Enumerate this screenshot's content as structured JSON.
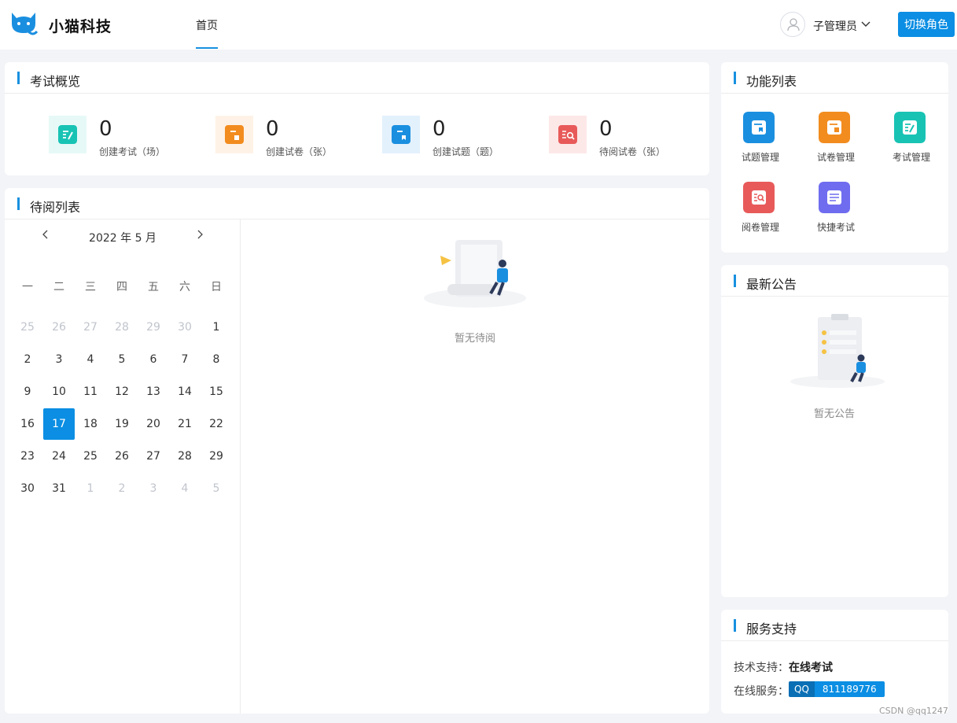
{
  "header": {
    "brand": "小猫科技",
    "nav_home": "首页",
    "user_name": "子管理员",
    "switch_role": "切换角色"
  },
  "overview": {
    "title": "考试概览",
    "stats": [
      {
        "value": "0",
        "label": "创建考试（场）",
        "color": "#18c3b4"
      },
      {
        "value": "0",
        "label": "创建试卷（张）",
        "color": "#f28c1f"
      },
      {
        "value": "0",
        "label": "创建试题（题）",
        "color": "#1a8fe0"
      },
      {
        "value": "0",
        "label": "待阅试卷（张）",
        "color": "#e85a5a"
      }
    ]
  },
  "pending": {
    "title": "待阅列表",
    "empty_text": "暂无待阅",
    "calendar": {
      "title": "2022 年 5 月",
      "weekdays": [
        "一",
        "二",
        "三",
        "四",
        "五",
        "六",
        "日"
      ],
      "selected_day": "17",
      "weeks": [
        [
          "25",
          "26",
          "27",
          "28",
          "29",
          "30",
          "1"
        ],
        [
          "2",
          "3",
          "4",
          "5",
          "6",
          "7",
          "8"
        ],
        [
          "9",
          "10",
          "11",
          "12",
          "13",
          "14",
          "15"
        ],
        [
          "16",
          "17",
          "18",
          "19",
          "20",
          "21",
          "22"
        ],
        [
          "23",
          "24",
          "25",
          "26",
          "27",
          "28",
          "29"
        ],
        [
          "30",
          "31",
          "1",
          "2",
          "3",
          "4",
          "5"
        ]
      ]
    }
  },
  "functions": {
    "title": "功能列表",
    "items": [
      {
        "label": "试题管理",
        "color": "#1a8fe0",
        "icon": "question-icon"
      },
      {
        "label": "试卷管理",
        "color": "#f28c1f",
        "icon": "paper-icon"
      },
      {
        "label": "考试管理",
        "color": "#18c3b4",
        "icon": "exam-icon"
      },
      {
        "label": "阅卷管理",
        "color": "#e85a5a",
        "icon": "grading-icon"
      },
      {
        "label": "快捷考试",
        "color": "#6f6cf0",
        "icon": "quick-exam-icon"
      }
    ]
  },
  "announcements": {
    "title": "最新公告",
    "empty_text": "暂无公告"
  },
  "service": {
    "title": "服务支持",
    "tech_label": "技术支持：",
    "tech_value": "在线考试",
    "online_label": "在线服务：",
    "qq_label": "QQ",
    "qq_number": "811189776"
  },
  "watermark": "CSDN @qq1247"
}
